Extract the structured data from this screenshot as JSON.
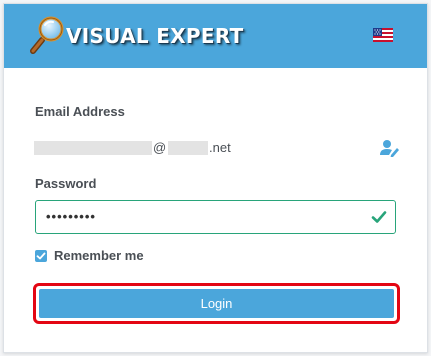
{
  "header": {
    "logo_text": "VISUAL EXPERT",
    "logo_icon": "magnifier-icon",
    "language_icon": "us-flag-icon"
  },
  "form": {
    "email_label": "Email Address",
    "email_value": {
      "separator": "@",
      "domain_suffix": ".net"
    },
    "email_action_icon": "user-edit-icon",
    "password_label": "Password",
    "password_value": "•••••••••",
    "password_valid_icon": "check-icon",
    "remember_label": "Remember me",
    "remember_checked": true,
    "login_label": "Login"
  },
  "colors": {
    "accent": "#4ba6db",
    "valid": "#28a47a",
    "highlight": "#e30613"
  }
}
